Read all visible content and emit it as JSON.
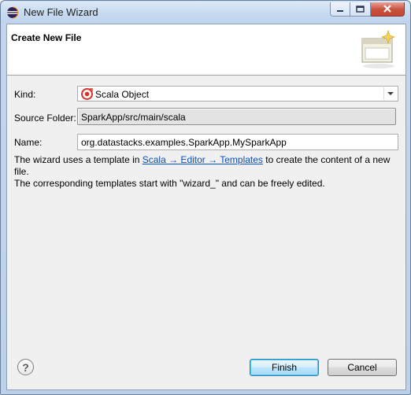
{
  "window": {
    "title": "New File Wizard",
    "controls": {
      "minimize": "–",
      "maximize": "□",
      "close": "✕"
    }
  },
  "header": {
    "title": "Create New File",
    "image_icon": "new-file-wizard-banner-icon"
  },
  "form": {
    "kind_label": "Kind:",
    "kind_value": "Scala Object",
    "kind_icon": "scala-object-icon",
    "source_folder_label": "Source Folder:",
    "source_folder_value": "SparkApp/src/main/scala",
    "name_label": "Name:",
    "name_value": "org.datastacks.examples.SparkApp.MySparkApp"
  },
  "info": {
    "prefix": "The wizard uses a template in ",
    "link": "Scala → Editor → Templates",
    "suffix_line1": " to create the content of a new file.",
    "line2": "The corresponding templates start with \"wizard_\" and can be freely edited."
  },
  "footer": {
    "help_glyph": "?",
    "finish_label": "Finish",
    "cancel_label": "Cancel"
  },
  "colors": {
    "link": "#0b4fb5",
    "scala_red": "#d9322b",
    "dialog_bg": "#f0f0f0"
  }
}
